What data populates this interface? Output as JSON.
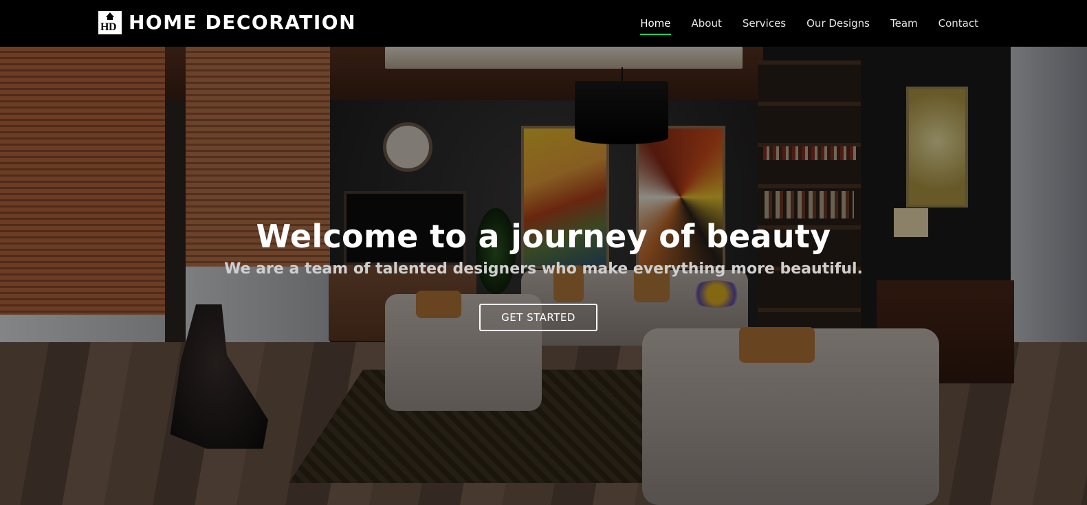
{
  "brand": {
    "logo_text": "HD",
    "name": "HOME DECORATION"
  },
  "nav": {
    "items": [
      {
        "label": "Home",
        "active": true
      },
      {
        "label": "About",
        "active": false
      },
      {
        "label": "Services",
        "active": false
      },
      {
        "label": "Our Designs",
        "active": false
      },
      {
        "label": "Team",
        "active": false
      },
      {
        "label": "Contact",
        "active": false
      }
    ],
    "active_underline_color": "#18d26e"
  },
  "hero": {
    "title": "Welcome to a journey of beauty",
    "subtitle": "We are a team of talented designers who make everything more beautiful.",
    "cta_label": "GET STARTED",
    "background": "living-room-interior-photo"
  }
}
